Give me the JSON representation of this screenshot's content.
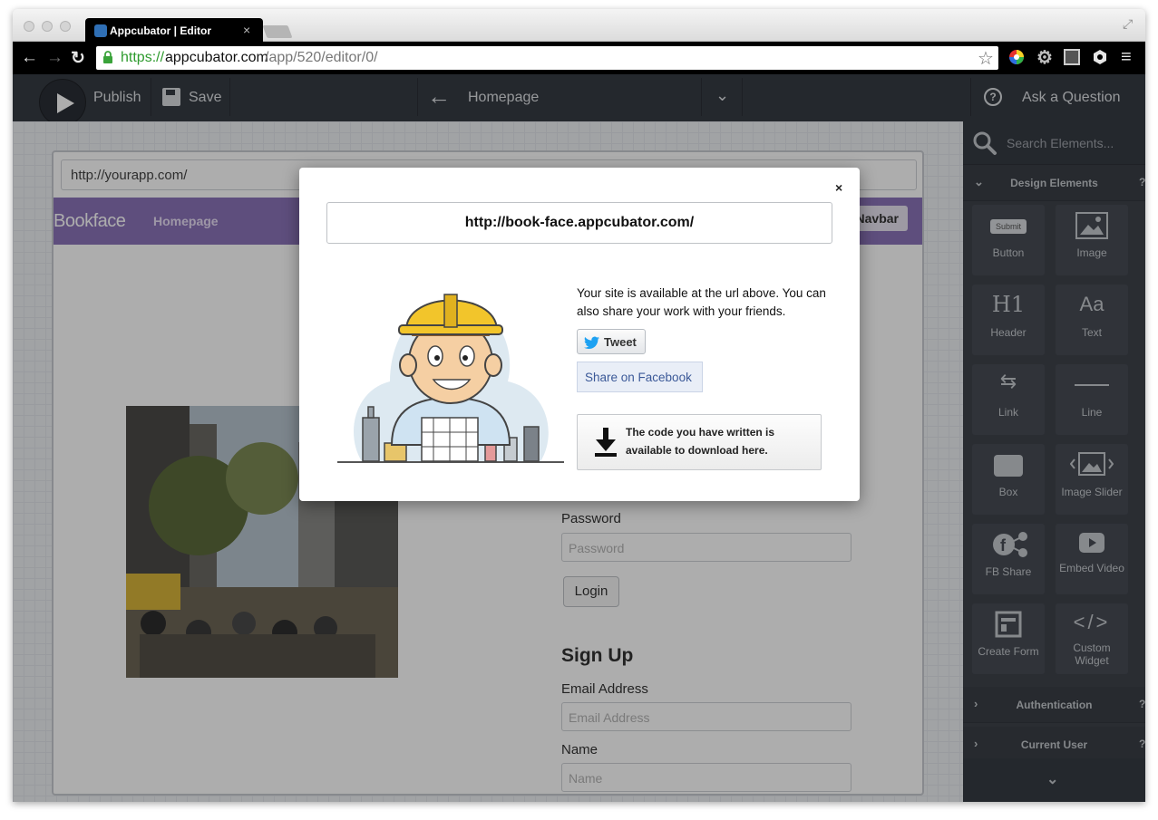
{
  "browser": {
    "tab_title": "Appcubator | Editor",
    "tab_close": "×",
    "url_scheme": "https://",
    "url_host": "appcubator.com",
    "url_path": "/app/520/editor/0/"
  },
  "toolbar": {
    "publish_label": "Publish",
    "save_label": "Save",
    "page_label": "Homepage",
    "ask_label": "Ask a Question"
  },
  "app_preview": {
    "url_value": "http://yourapp.com/",
    "brand": "Bookface",
    "nav_homepage": "Homepage",
    "nav_button": "Navbar",
    "password_label": "Password",
    "password_placeholder": "Password",
    "login_button": "Login",
    "signup_title": "Sign Up",
    "email_label": "Email Address",
    "email_placeholder": "Email Address",
    "name_label": "Name",
    "name_placeholder": "Name"
  },
  "sidebar": {
    "search_placeholder": "Search Elements...",
    "design_title": "Design Elements",
    "help_mark": "?",
    "elements": [
      {
        "label": "Button",
        "icon_text": "Submit"
      },
      {
        "label": "Image"
      },
      {
        "label": "Header",
        "icon_text": "H1"
      },
      {
        "label": "Text",
        "icon_text": "Aa"
      },
      {
        "label": "Link"
      },
      {
        "label": "Line"
      },
      {
        "label": "Box"
      },
      {
        "label": "Image Slider"
      },
      {
        "label": "FB Share"
      },
      {
        "label": "Embed Video"
      },
      {
        "label": "Create Form"
      },
      {
        "label": "Custom Widget",
        "icon_text": "</>"
      }
    ],
    "auth_title": "Authentication",
    "current_user_title": "Current User"
  },
  "modal": {
    "close": "×",
    "site_url": "http://book-face.appcubator.com/",
    "available_text": "Your site is available at the url above. You can also share your work with your friends.",
    "tweet_label": "Tweet",
    "facebook_label": "Share on Facebook",
    "download_text": "The code you have written is available to download here."
  },
  "colors": {
    "toolbar_bg": "#363b43",
    "sidebar_bg": "#3e434b",
    "navbar_purple": "#8b74b8",
    "secure_green": "#2e9b2e",
    "facebook_blue": "#3b5998",
    "twitter_blue": "#1da1f2"
  }
}
